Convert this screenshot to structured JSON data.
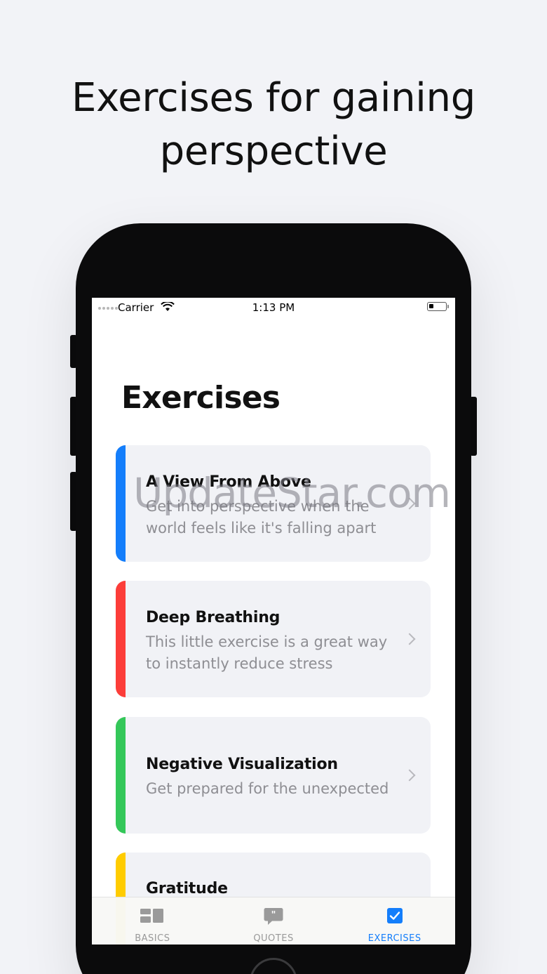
{
  "headline": {
    "line1": "Exercises for gaining",
    "line2": "perspective"
  },
  "status_bar": {
    "carrier": "Carrier",
    "time": "1:13 PM"
  },
  "screen": {
    "title": "Exercises"
  },
  "watermark": "UpdateStar.com",
  "exercises": [
    {
      "title": "A View From Above",
      "desc1": "Get into perspective when the",
      "desc2": "world feels like it's falling apart",
      "color": "#147efb"
    },
    {
      "title": "Deep Breathing",
      "desc1": "This little exercise is a great way",
      "desc2": "to instantly reduce stress",
      "color": "#fc3d39"
    },
    {
      "title": "Negative Visualization",
      "desc1": "Get prepared for the unexpected",
      "desc2": "",
      "color": "#34c759"
    },
    {
      "title": "Gratitude",
      "desc1": "",
      "desc2": "",
      "color": "#ffcc00"
    }
  ],
  "tabs": [
    {
      "label": "BASICS",
      "icon": "basics-icon",
      "active": false
    },
    {
      "label": "QUOTES",
      "icon": "quotes-icon",
      "active": false
    },
    {
      "label": "EXERCISES",
      "icon": "checkbox-icon",
      "active": true
    }
  ],
  "colors": {
    "accent": "#147efb",
    "background": "#f2f3f7",
    "card": "#f1f2f6"
  }
}
